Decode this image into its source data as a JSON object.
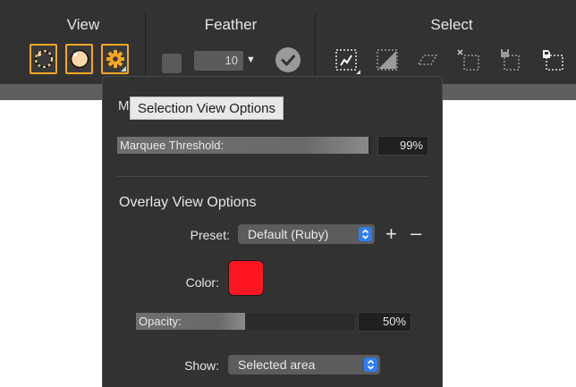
{
  "toolbar": {
    "groups": [
      {
        "label": "View"
      },
      {
        "label": "Feather"
      },
      {
        "label": "Select"
      }
    ],
    "view_buttons": [
      {
        "icon": "marching-ants-circle-icon",
        "selected": true
      },
      {
        "icon": "overlay-circle-icon",
        "selected": true
      },
      {
        "icon": "gear-icon",
        "selected": true
      }
    ],
    "feather": {
      "value": "10",
      "dropdown_icon": "triangle-down-icon",
      "apply_icon": "checkmark-circle-icon"
    },
    "select_icons": [
      "selection-brush-icon",
      "gradient-selection-icon",
      "freehand-parallelogram-icon",
      "deselect-icon",
      "save-selection-icon",
      "load-selection-icon"
    ],
    "accent_color": "#f5a623"
  },
  "popover": {
    "partial_title": "M",
    "tooltip": "Selection View Options",
    "marquee": {
      "label": "Marquee Threshold:",
      "value": "99%",
      "level": 0.99
    },
    "overlay": {
      "title": "Overlay View Options",
      "preset_label": "Preset:",
      "preset_value": "Default (Ruby)",
      "add_glyph": "+",
      "remove_glyph": "–",
      "color_label": "Color:",
      "color_value": "#ff1421",
      "opacity_label": "Opacity:",
      "opacity_value": "50%",
      "opacity_level": 0.5,
      "show_label": "Show:",
      "show_value": "Selected area"
    }
  }
}
